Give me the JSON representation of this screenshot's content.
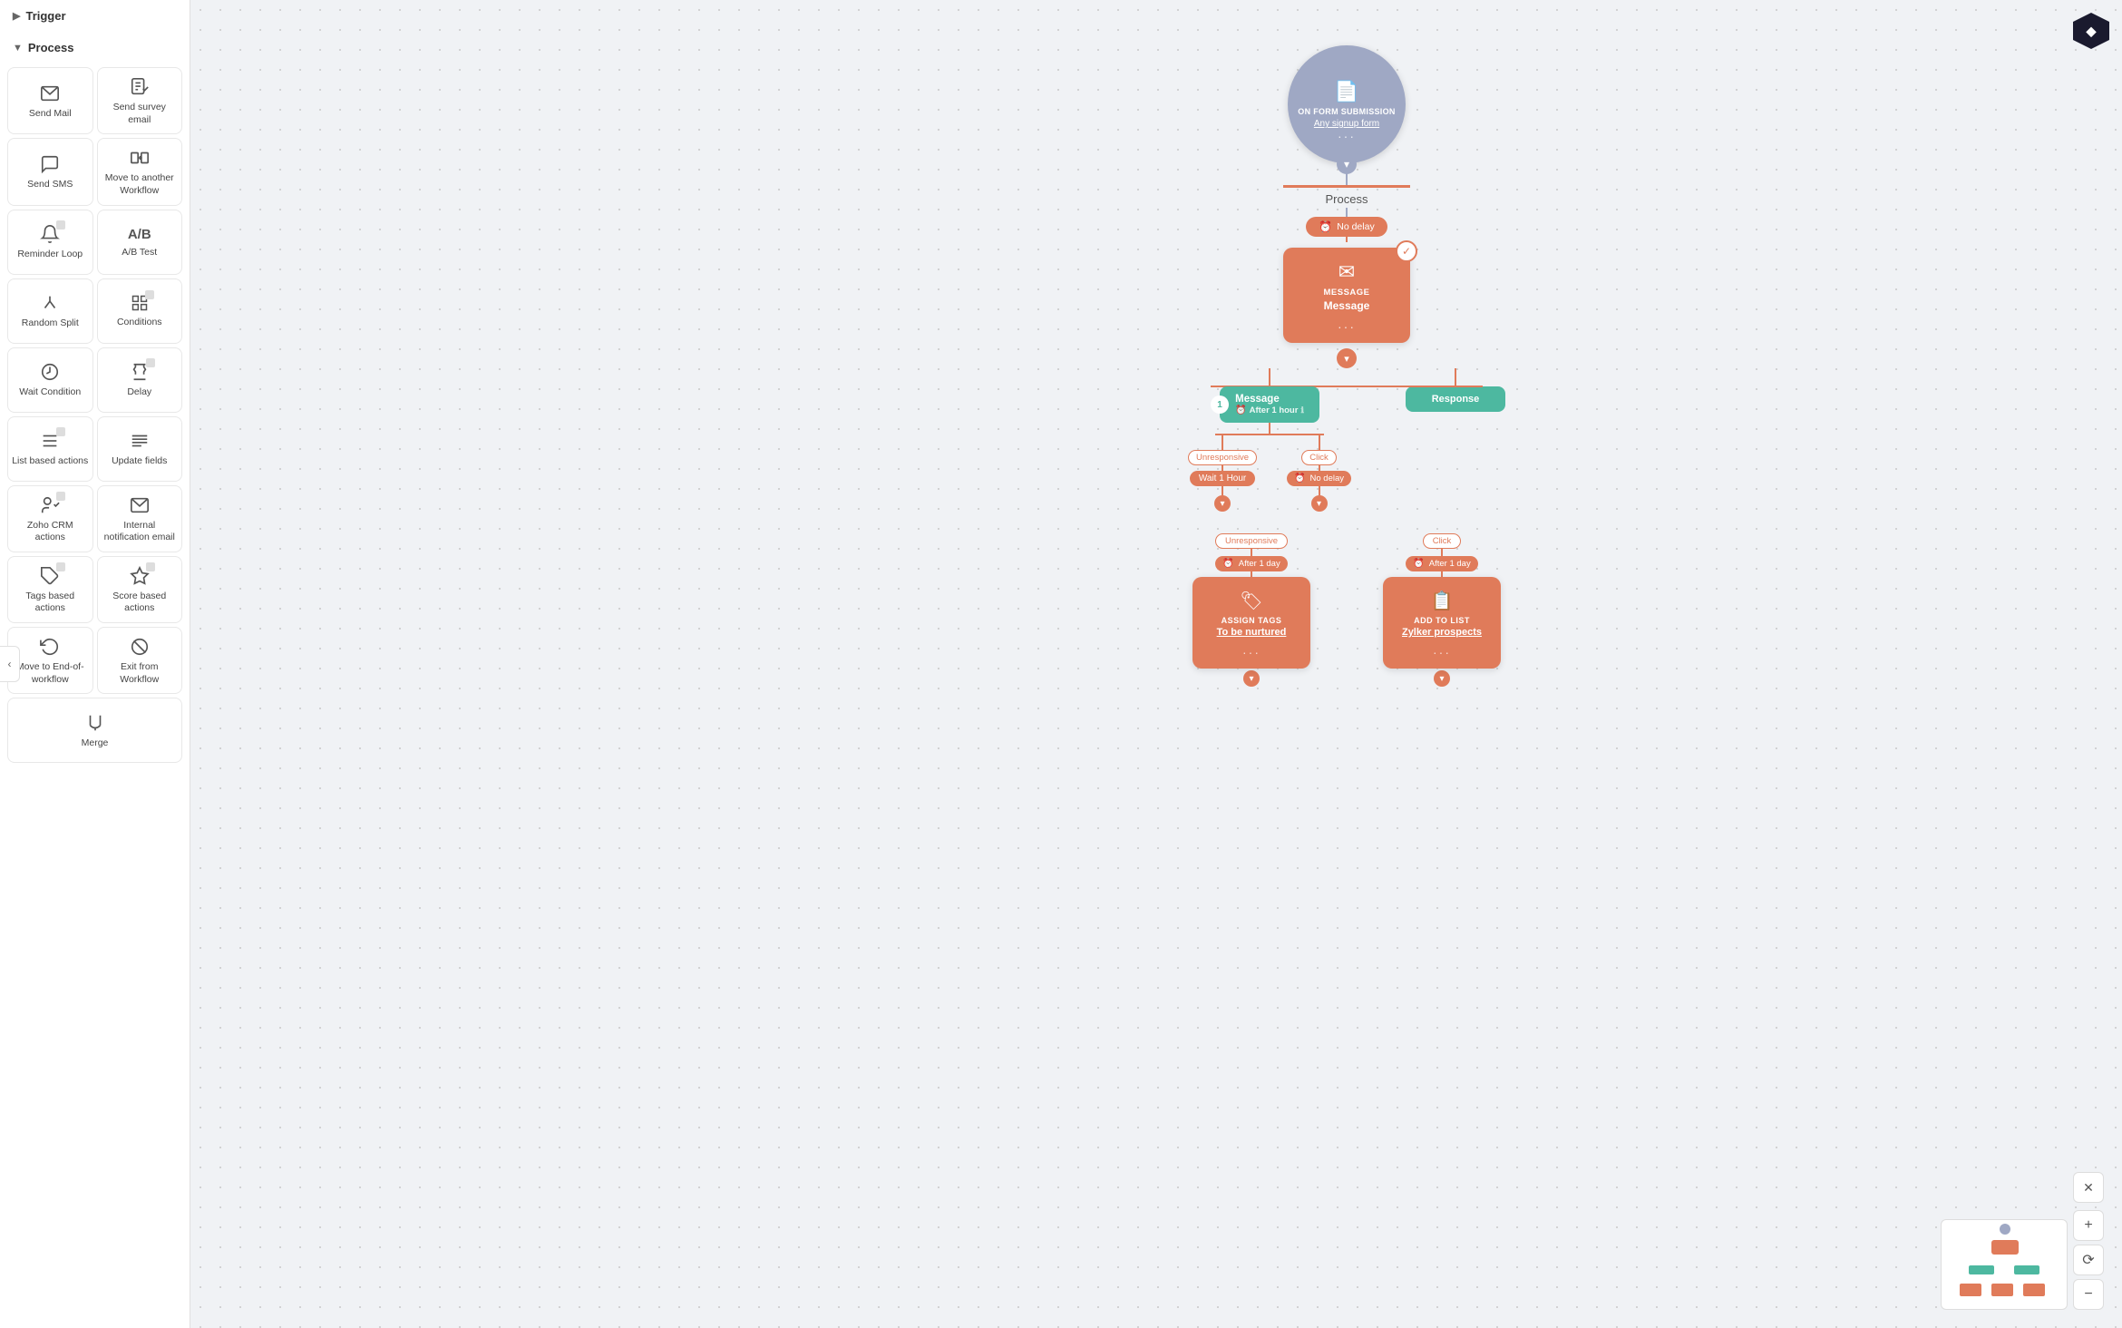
{
  "sidebar": {
    "trigger_label": "Trigger",
    "process_label": "Process",
    "items": [
      {
        "id": "send-mail",
        "label": "Send Mail",
        "icon": "✉"
      },
      {
        "id": "send-survey",
        "label": "Send survey email",
        "icon": "📋"
      },
      {
        "id": "send-sms",
        "label": "Send SMS",
        "icon": "💬"
      },
      {
        "id": "move-workflow",
        "label": "Move to another Workflow",
        "icon": "↗"
      },
      {
        "id": "reminder-loop",
        "label": "Reminder Loop",
        "icon": "🔔",
        "stacked": true
      },
      {
        "id": "ab-test",
        "label": "A/B Test",
        "icon": "A/B"
      },
      {
        "id": "random-split",
        "label": "Random Split",
        "icon": "⑂"
      },
      {
        "id": "conditions",
        "label": "Conditions",
        "icon": "⊞",
        "stacked": true
      },
      {
        "id": "wait-condition",
        "label": "Wait Condition",
        "icon": "⏳"
      },
      {
        "id": "delay",
        "label": "Delay",
        "icon": "⌛",
        "stacked": true
      },
      {
        "id": "list-actions",
        "label": "List based actions",
        "icon": "☰",
        "stacked": true
      },
      {
        "id": "update-fields",
        "label": "Update fields",
        "icon": "≡"
      },
      {
        "id": "zoho-crm",
        "label": "Zoho CRM actions",
        "icon": "🤝",
        "stacked": true
      },
      {
        "id": "internal-notif",
        "label": "Internal notification email",
        "icon": "📧"
      },
      {
        "id": "tags-actions",
        "label": "Tags based actions",
        "icon": "🏷",
        "stacked": true
      },
      {
        "id": "score-actions",
        "label": "Score based actions",
        "icon": "🏆",
        "stacked": true
      },
      {
        "id": "move-end",
        "label": "Move to End-of-workflow",
        "icon": "↩"
      },
      {
        "id": "exit-workflow",
        "label": "Exit from Workflow",
        "icon": "⊗"
      },
      {
        "id": "merge",
        "label": "Merge",
        "icon": "⬇"
      }
    ]
  },
  "canvas": {
    "trigger_node": {
      "title": "ON FORM SUBMISSION",
      "sub": "Any signup form",
      "icon": "📄"
    },
    "process_label": "Process",
    "no_delay": "No delay",
    "message_node": {
      "title": "MESSAGE",
      "name": "Message"
    },
    "branches": {
      "left": {
        "label": "Message",
        "delay": "After 1 hour",
        "num": "1"
      },
      "right": {
        "label": "Response"
      }
    },
    "sub_branches": {
      "left_label": "Unresponsive",
      "left_delay": "Wait 1 Hour",
      "right_label": "Click",
      "right_delay": "No delay"
    },
    "bottom_left": {
      "label": "Unresponsive",
      "delay": "After 1 day",
      "action_title": "ASSIGN TAGS",
      "action_name": "To be nurtured"
    },
    "bottom_right": {
      "label": "Click",
      "delay": "After 1 day",
      "action_title": "ADD TO LIST",
      "action_name": "Zylker prospects"
    }
  },
  "zoom": {
    "close": "✕",
    "zoom_in": "+",
    "zoom_out": "−",
    "reset": "⟳"
  }
}
